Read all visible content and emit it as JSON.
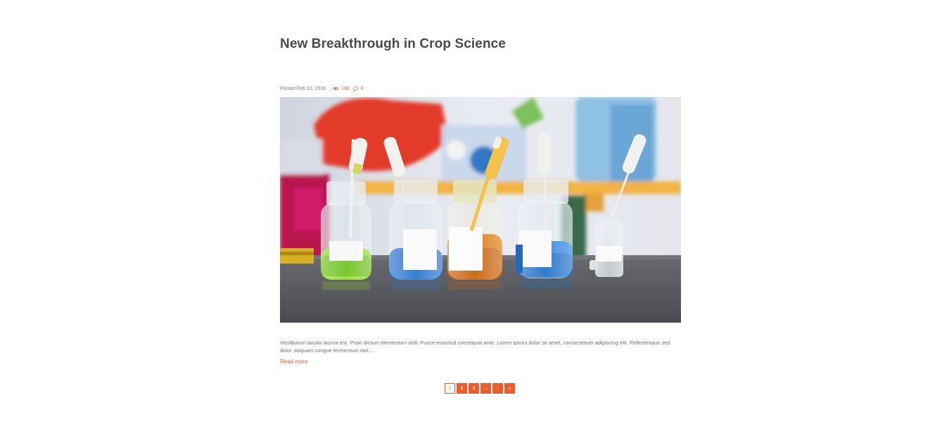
{
  "post": {
    "title": "New Breakthrough in Crop Science",
    "posted": "Posted Feb 10, 2016",
    "views": "136",
    "comments": "0",
    "image_alt": "Glass jars with colored liquids and pipettes",
    "excerpt": "Vestibulum iaculis lacinia est. Proin dictum elementum velit. Fusce euismod consequat ante. Lorem ipsum dolor sit amet, consectetuer adipiscing elit. Pellentesque sed dolor. Aliquam congue fermentum nisl…",
    "read_more": "Read more"
  },
  "pagination": {
    "pages": [
      "1",
      "2",
      "3",
      "…",
      "›",
      "»"
    ],
    "current": "1"
  },
  "colors": {
    "accent": "#ef5b2a",
    "title": "#4a4a4a",
    "text": "#6f6f6f"
  },
  "icons": {
    "views": "eye-icon",
    "comments": "comment-bubble-icon"
  }
}
